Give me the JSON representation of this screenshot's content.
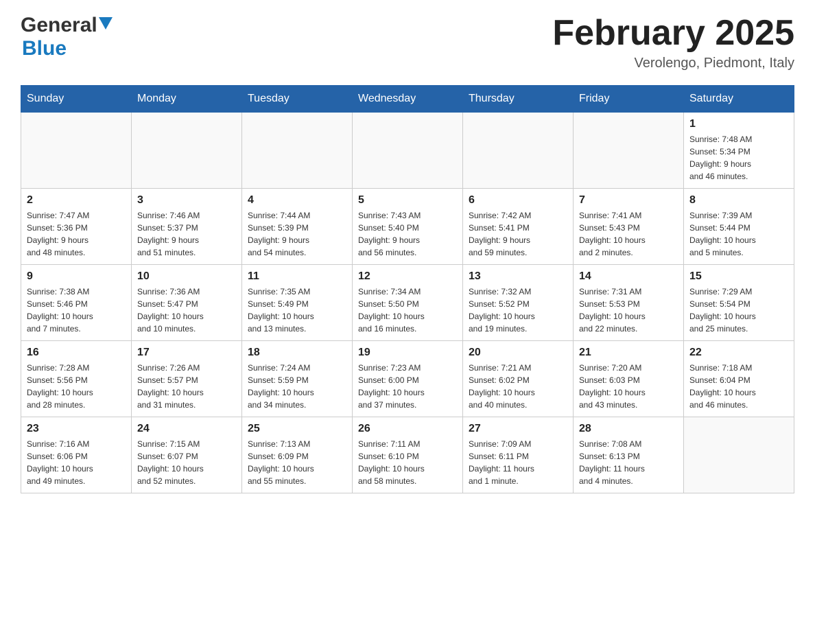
{
  "header": {
    "logo_general": "General",
    "logo_blue": "Blue",
    "month_title": "February 2025",
    "location": "Verolengo, Piedmont, Italy"
  },
  "days_of_week": [
    "Sunday",
    "Monday",
    "Tuesday",
    "Wednesday",
    "Thursday",
    "Friday",
    "Saturday"
  ],
  "weeks": [
    [
      {
        "day": "",
        "info": ""
      },
      {
        "day": "",
        "info": ""
      },
      {
        "day": "",
        "info": ""
      },
      {
        "day": "",
        "info": ""
      },
      {
        "day": "",
        "info": ""
      },
      {
        "day": "",
        "info": ""
      },
      {
        "day": "1",
        "info": "Sunrise: 7:48 AM\nSunset: 5:34 PM\nDaylight: 9 hours\nand 46 minutes."
      }
    ],
    [
      {
        "day": "2",
        "info": "Sunrise: 7:47 AM\nSunset: 5:36 PM\nDaylight: 9 hours\nand 48 minutes."
      },
      {
        "day": "3",
        "info": "Sunrise: 7:46 AM\nSunset: 5:37 PM\nDaylight: 9 hours\nand 51 minutes."
      },
      {
        "day": "4",
        "info": "Sunrise: 7:44 AM\nSunset: 5:39 PM\nDaylight: 9 hours\nand 54 minutes."
      },
      {
        "day": "5",
        "info": "Sunrise: 7:43 AM\nSunset: 5:40 PM\nDaylight: 9 hours\nand 56 minutes."
      },
      {
        "day": "6",
        "info": "Sunrise: 7:42 AM\nSunset: 5:41 PM\nDaylight: 9 hours\nand 59 minutes."
      },
      {
        "day": "7",
        "info": "Sunrise: 7:41 AM\nSunset: 5:43 PM\nDaylight: 10 hours\nand 2 minutes."
      },
      {
        "day": "8",
        "info": "Sunrise: 7:39 AM\nSunset: 5:44 PM\nDaylight: 10 hours\nand 5 minutes."
      }
    ],
    [
      {
        "day": "9",
        "info": "Sunrise: 7:38 AM\nSunset: 5:46 PM\nDaylight: 10 hours\nand 7 minutes."
      },
      {
        "day": "10",
        "info": "Sunrise: 7:36 AM\nSunset: 5:47 PM\nDaylight: 10 hours\nand 10 minutes."
      },
      {
        "day": "11",
        "info": "Sunrise: 7:35 AM\nSunset: 5:49 PM\nDaylight: 10 hours\nand 13 minutes."
      },
      {
        "day": "12",
        "info": "Sunrise: 7:34 AM\nSunset: 5:50 PM\nDaylight: 10 hours\nand 16 minutes."
      },
      {
        "day": "13",
        "info": "Sunrise: 7:32 AM\nSunset: 5:52 PM\nDaylight: 10 hours\nand 19 minutes."
      },
      {
        "day": "14",
        "info": "Sunrise: 7:31 AM\nSunset: 5:53 PM\nDaylight: 10 hours\nand 22 minutes."
      },
      {
        "day": "15",
        "info": "Sunrise: 7:29 AM\nSunset: 5:54 PM\nDaylight: 10 hours\nand 25 minutes."
      }
    ],
    [
      {
        "day": "16",
        "info": "Sunrise: 7:28 AM\nSunset: 5:56 PM\nDaylight: 10 hours\nand 28 minutes."
      },
      {
        "day": "17",
        "info": "Sunrise: 7:26 AM\nSunset: 5:57 PM\nDaylight: 10 hours\nand 31 minutes."
      },
      {
        "day": "18",
        "info": "Sunrise: 7:24 AM\nSunset: 5:59 PM\nDaylight: 10 hours\nand 34 minutes."
      },
      {
        "day": "19",
        "info": "Sunrise: 7:23 AM\nSunset: 6:00 PM\nDaylight: 10 hours\nand 37 minutes."
      },
      {
        "day": "20",
        "info": "Sunrise: 7:21 AM\nSunset: 6:02 PM\nDaylight: 10 hours\nand 40 minutes."
      },
      {
        "day": "21",
        "info": "Sunrise: 7:20 AM\nSunset: 6:03 PM\nDaylight: 10 hours\nand 43 minutes."
      },
      {
        "day": "22",
        "info": "Sunrise: 7:18 AM\nSunset: 6:04 PM\nDaylight: 10 hours\nand 46 minutes."
      }
    ],
    [
      {
        "day": "23",
        "info": "Sunrise: 7:16 AM\nSunset: 6:06 PM\nDaylight: 10 hours\nand 49 minutes."
      },
      {
        "day": "24",
        "info": "Sunrise: 7:15 AM\nSunset: 6:07 PM\nDaylight: 10 hours\nand 52 minutes."
      },
      {
        "day": "25",
        "info": "Sunrise: 7:13 AM\nSunset: 6:09 PM\nDaylight: 10 hours\nand 55 minutes."
      },
      {
        "day": "26",
        "info": "Sunrise: 7:11 AM\nSunset: 6:10 PM\nDaylight: 10 hours\nand 58 minutes."
      },
      {
        "day": "27",
        "info": "Sunrise: 7:09 AM\nSunset: 6:11 PM\nDaylight: 11 hours\nand 1 minute."
      },
      {
        "day": "28",
        "info": "Sunrise: 7:08 AM\nSunset: 6:13 PM\nDaylight: 11 hours\nand 4 minutes."
      },
      {
        "day": "",
        "info": ""
      }
    ]
  ]
}
